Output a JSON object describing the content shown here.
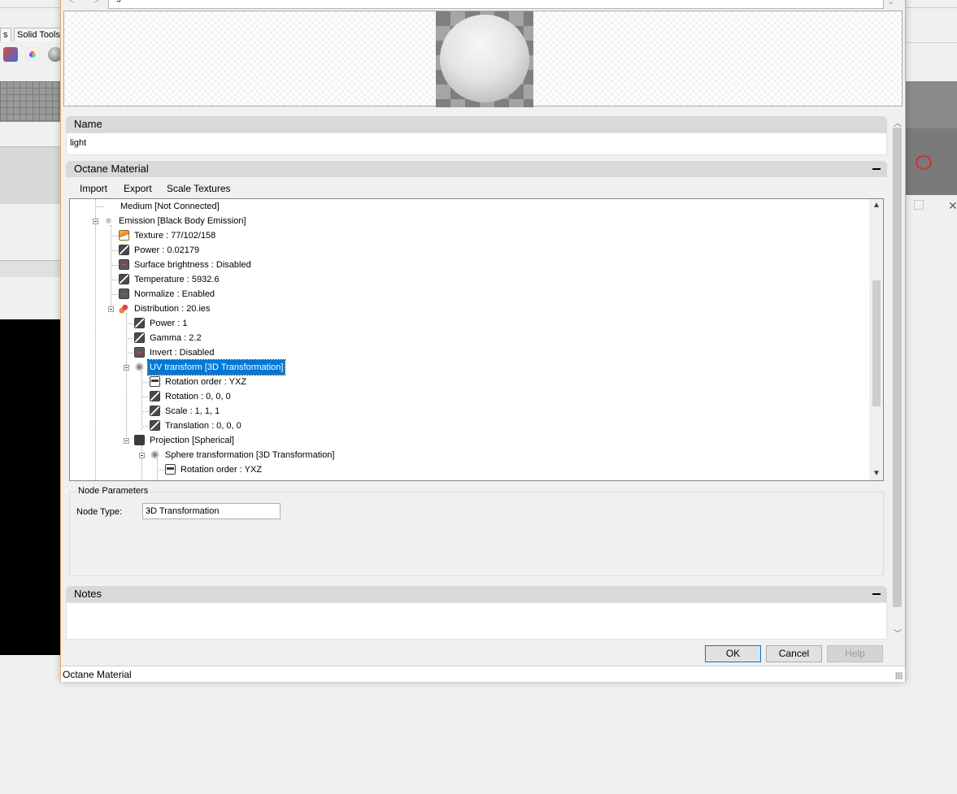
{
  "window": {
    "path_text": "light"
  },
  "background_app": {
    "tabs": [
      "s",
      "Solid Tools"
    ]
  },
  "name_section": {
    "header": "Name",
    "value": "light"
  },
  "material_section": {
    "header": "Octane Material",
    "menu": [
      "Import",
      "Export",
      "Scale Textures"
    ],
    "tree": [
      {
        "label": "Medium  [Not Connected]",
        "icon": "none-icon"
      },
      {
        "label": "Emission  [Black Body Emission]",
        "icon": "emission-icon"
      },
      {
        "label": "Texture : 77/102/158",
        "icon": "texture-icon"
      },
      {
        "label": "Power : 0.02179",
        "icon": "float-param-icon"
      },
      {
        "label": "Surface brightness : Disabled",
        "icon": "bool-param-icon"
      },
      {
        "label": "Temperature : 5932.6",
        "icon": "float-param-icon"
      },
      {
        "label": "Normalize : Enabled",
        "icon": "bool-param-icon"
      },
      {
        "label": "Distribution : 20.ies",
        "icon": "distribution-icon"
      },
      {
        "label": "Power : 1",
        "icon": "float-param-icon"
      },
      {
        "label": "Gamma : 2.2",
        "icon": "float-param-icon"
      },
      {
        "label": "Invert : Disabled",
        "icon": "bool-param-icon"
      },
      {
        "label": "UV transform  [3D Transformation]",
        "icon": "transform-icon",
        "selected": true
      },
      {
        "label": "Rotation order : YXZ",
        "icon": "enum-param-icon"
      },
      {
        "label": "Rotation : 0, 0, 0",
        "icon": "float-param-icon"
      },
      {
        "label": "Scale : 1, 1, 1",
        "icon": "float-param-icon"
      },
      {
        "label": "Translation : 0, 0, 0",
        "icon": "float-param-icon"
      },
      {
        "label": "Projection  [Spherical]",
        "icon": "projection-icon"
      },
      {
        "label": "Sphere transformation  [3D Transformation]",
        "icon": "transform-icon"
      },
      {
        "label": "Rotation order : YXZ",
        "icon": "enum-param-icon"
      }
    ]
  },
  "node_parameters": {
    "legend": "Node Parameters",
    "type_label": "Node Type:",
    "type_value": "3D Transformation"
  },
  "notes_section": {
    "header": "Notes"
  },
  "buttons": {
    "ok": "OK",
    "cancel": "Cancel",
    "help": "Help"
  },
  "status": "Octane Material",
  "colors": {
    "selection": "#0078d7",
    "dialog_border": "#e3a86d",
    "accent": "#0078d7"
  }
}
